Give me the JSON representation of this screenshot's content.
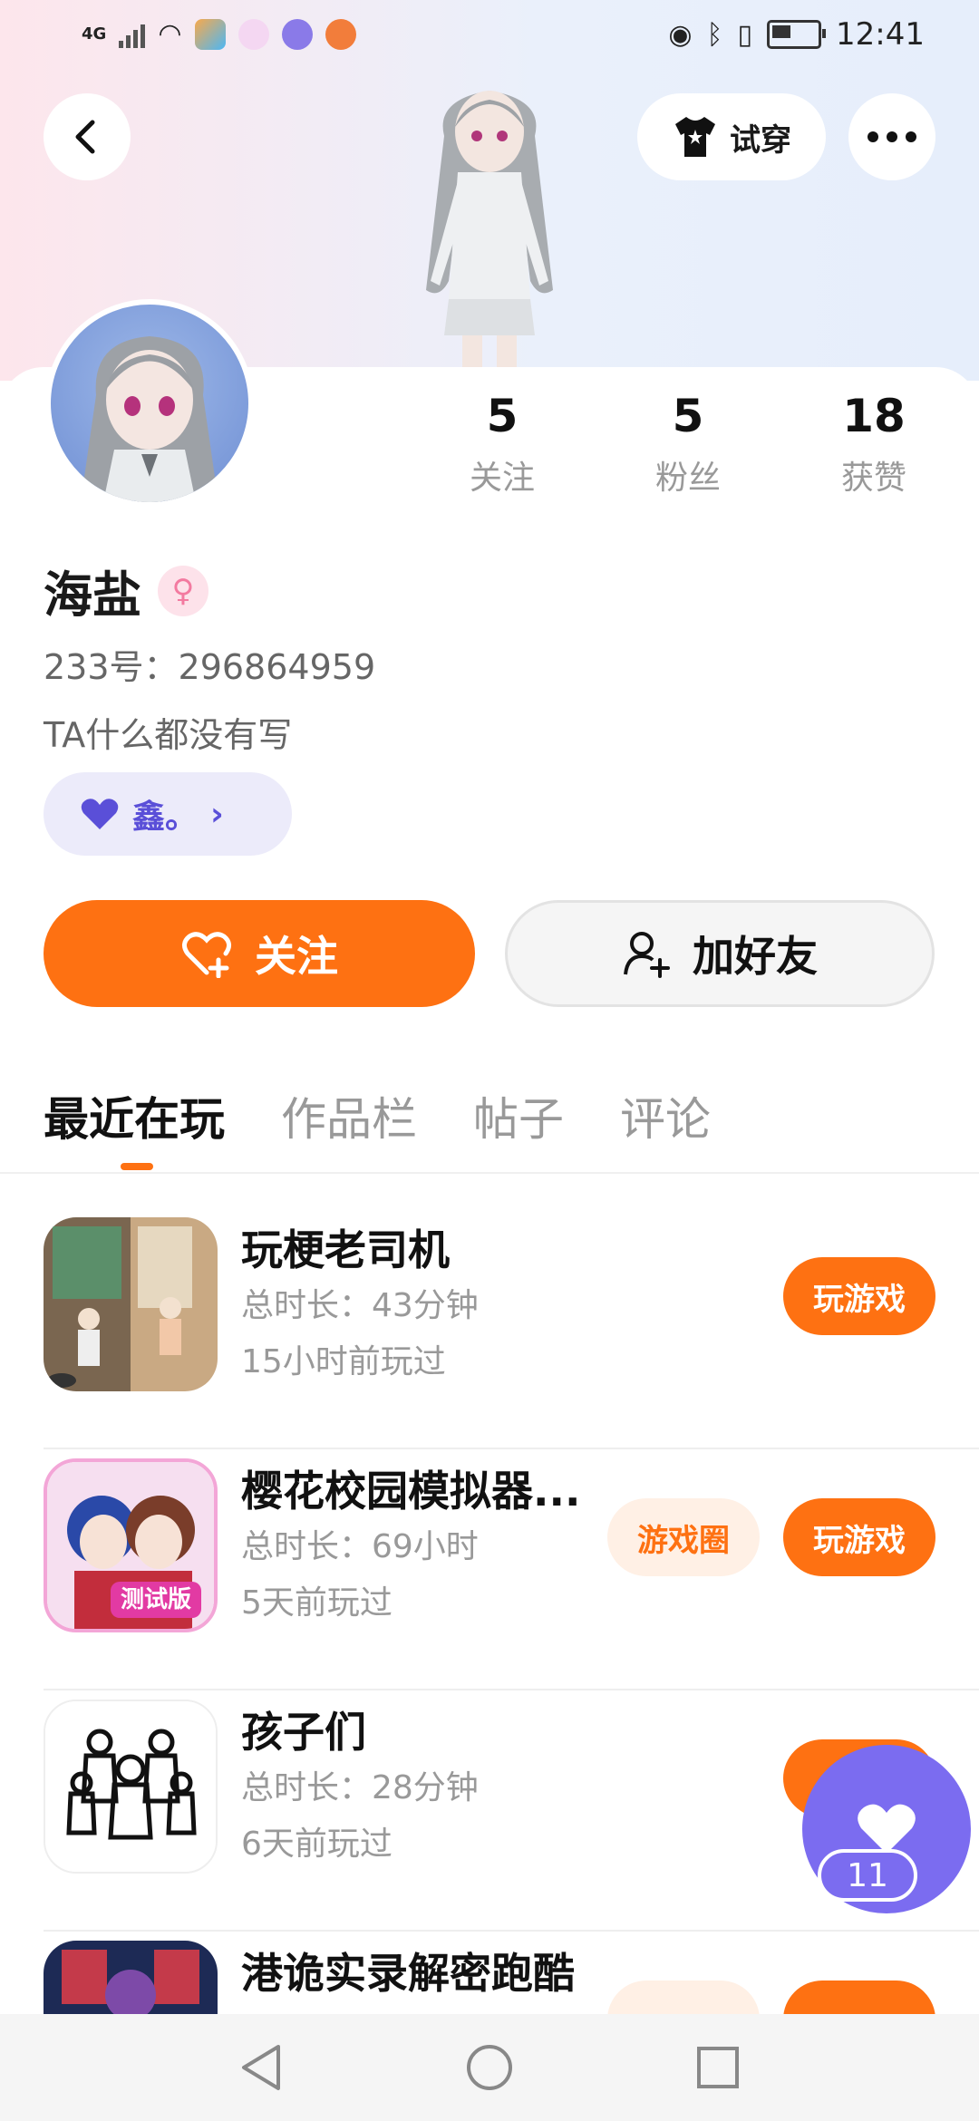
{
  "status_bar": {
    "network": "4G",
    "time": "12:41"
  },
  "header": {
    "tryon_label": "试穿"
  },
  "profile": {
    "stats": [
      {
        "value": "5",
        "label": "关注"
      },
      {
        "value": "5",
        "label": "粉丝"
      },
      {
        "value": "18",
        "label": "获赞"
      }
    ],
    "name": "海盐",
    "uid": "233号：296864959",
    "bio": "TA什么都没有写",
    "tag": "鑫。"
  },
  "actions": {
    "follow_label": "关注",
    "add_friend_label": "加好友"
  },
  "tabs": [
    {
      "label": "最近在玩",
      "active": true
    },
    {
      "label": "作品栏",
      "active": false
    },
    {
      "label": "帖子",
      "active": false
    },
    {
      "label": "评论",
      "active": false
    }
  ],
  "games": [
    {
      "name": "玩梗老司机",
      "duration": "总时长：43分钟",
      "last_played": "15小时前玩过",
      "play_label": "玩游戏"
    },
    {
      "name": "樱花校园模拟器...",
      "duration": "总时长：69小时",
      "last_played": "5天前玩过",
      "circle_label": "游戏圈",
      "play_label": "玩游戏",
      "badge": "测试版"
    },
    {
      "name": "孩子们",
      "duration": "总时长：28分钟",
      "last_played": "6天前玩过"
    },
    {
      "name": "港诡实录解密跑酷"
    }
  ],
  "fab": {
    "count": "11"
  },
  "colors": {
    "accent": "#fe7112",
    "purple": "#7b6cf0"
  }
}
